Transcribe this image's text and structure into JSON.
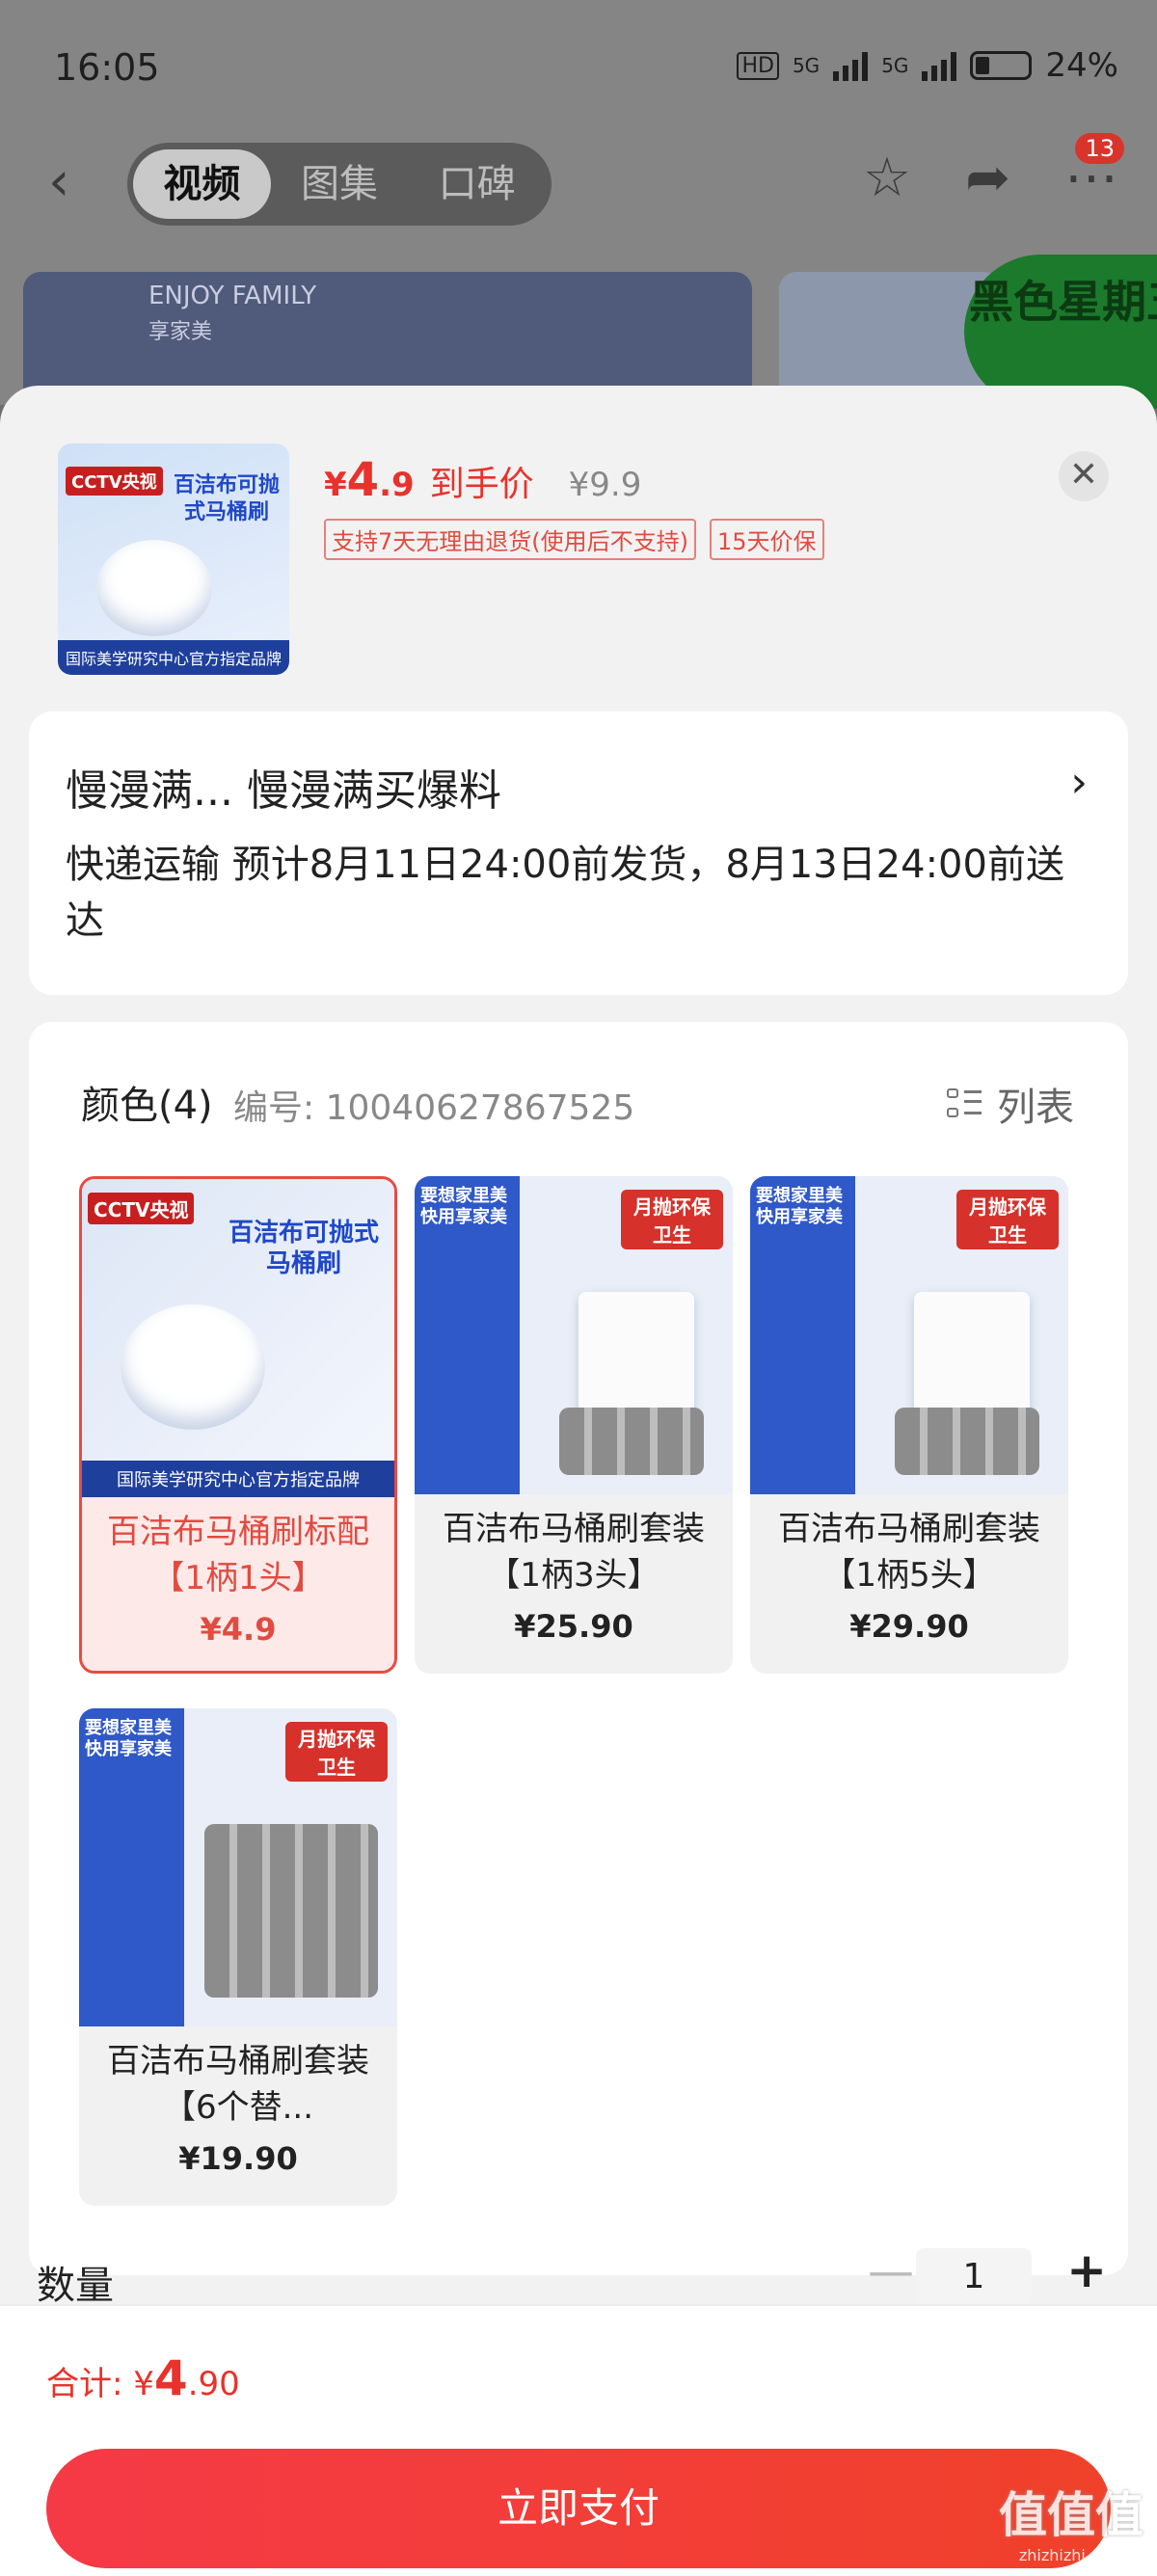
{
  "status_bar": {
    "time": "16:05",
    "hd": "HD",
    "net1": "5G",
    "net2": "5G",
    "battery": "24%"
  },
  "nav": {
    "tabs": [
      "视频",
      "图集",
      "口碑"
    ],
    "active_tab": 0,
    "notification_count": "13"
  },
  "background_banners": {
    "brand_en": "ENJOY FAMILY",
    "brand_cn": "享家美",
    "promo_text": "黑色星期五"
  },
  "product_header": {
    "price_symbol": "¥",
    "price_int": "4",
    "price_dec": ".9",
    "price_label": "到手价",
    "original_price": "¥9.9",
    "tags": [
      "支持7天无理由退货(使用后不支持)",
      "15天价保"
    ],
    "thumb_badge": "CCTV央视",
    "thumb_title": "百洁布可抛式马桶刷",
    "thumb_footer": "国际美学研究中心官方指定品牌"
  },
  "address": {
    "title": "慢漫满... 慢漫满买爆料",
    "shipping": "快递运输 预计8月11日24:00前发货，8月13日24:00前送达"
  },
  "options": {
    "title": "颜色(4)",
    "code": "编号: 10040627867525",
    "list_label": "列表",
    "items": [
      {
        "name": "百洁布马桶刷标配【1柄1头】",
        "price": "¥4.9",
        "badge": "CCTV央视",
        "caption": "百洁布可抛式马桶刷",
        "footer": "国际美学研究中心官方指定品牌",
        "selected": true
      },
      {
        "name": "百洁布马桶刷套装【1柄3头】",
        "price": "¥25.90",
        "badge": "月抛环保卫生",
        "brand": "要想家里美 快用享家美"
      },
      {
        "name": "百洁布马桶刷套装【1柄5头】",
        "price": "¥29.90",
        "badge": "月抛环保卫生",
        "brand": "要想家里美 快用享家美"
      },
      {
        "name": "百洁布马桶刷套装【6个替...",
        "price": "¥19.90",
        "badge": "月抛环保卫生",
        "brand": "要想家里美 快用享家美"
      }
    ]
  },
  "quantity": {
    "label": "数量",
    "value": "1"
  },
  "footer": {
    "total_label": "合计: ¥",
    "total_int": "4",
    "total_dec": ".90",
    "pay_button": "立即支付",
    "watermark": "值值值",
    "watermark_url": "zhizhizhi.com"
  }
}
